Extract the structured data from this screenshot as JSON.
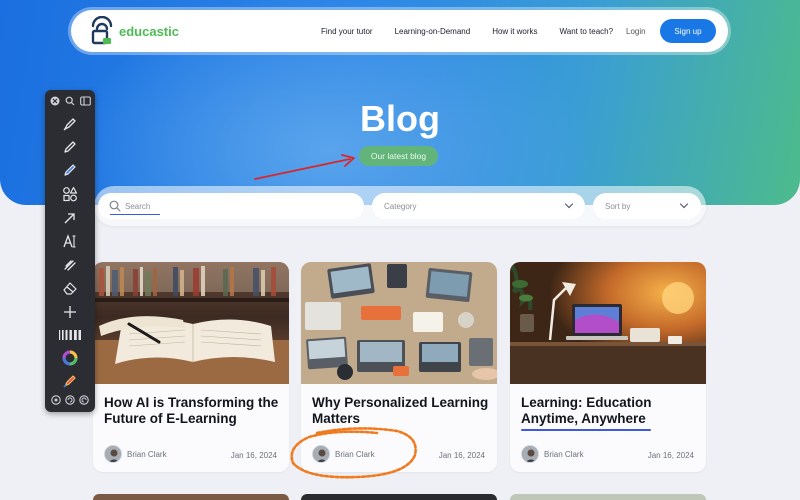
{
  "brand": {
    "name": "educastic",
    "accent": "#4dbd53",
    "primary": "#1a78e6"
  },
  "nav": {
    "links": [
      "Find your tutor",
      "Learning-on-Demand",
      "How it works",
      "Want to teach?"
    ],
    "login": "Login",
    "signup": "Sign up"
  },
  "hero": {
    "title": "Blog",
    "badge": "Our latest blog"
  },
  "filters": {
    "search_placeholder": "Search",
    "category_placeholder": "Category",
    "sort_placeholder": "Sort by"
  },
  "posts": [
    {
      "title": "How AI is Transforming the Future of E-Learning",
      "author": "Brian Clark",
      "date": "Jan 16, 2024",
      "image": "open-books-library"
    },
    {
      "title": "Why Personalized Learning Matters",
      "author": "Brian Clark",
      "date": "Jan 16, 2024",
      "image": "team-laptops-desk"
    },
    {
      "title": "Learning: Education Anytime, Anywhere",
      "author": "Brian Clark",
      "date": "Jan 16, 2024",
      "image": "laptop-lamp-desk"
    }
  ],
  "toolbar": {
    "tools": [
      "close-icon",
      "zoom-icon",
      "sidebar-icon",
      "marker-icon",
      "pencil-icon",
      "highlighter-icon",
      "shapes-icon",
      "arrow-icon",
      "text-icon",
      "blur-icon",
      "eraser-icon",
      "crosshair-icon",
      "line-width-icon",
      "color-wheel-icon",
      "color-picker-icon",
      "settings-icon",
      "undo-icon",
      "redo-icon"
    ]
  },
  "annotations": {
    "arrow_color": "#d9262b",
    "scribble_color": "#f07a1e"
  }
}
